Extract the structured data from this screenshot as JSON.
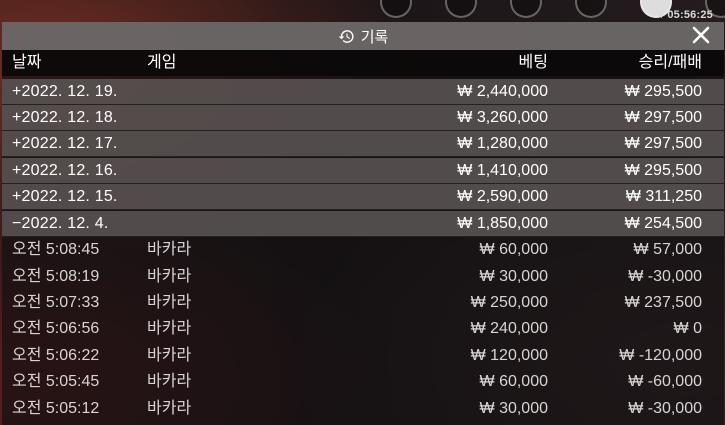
{
  "clock": "# 05:56:25",
  "title": "기록",
  "header": {
    "date": "날짜",
    "game": "게임",
    "bet": "베팅",
    "winloss": "승리/패배"
  },
  "summary_rows": [
    {
      "date": "+2022. 12. 19.",
      "bet": "₩ 2,440,000",
      "win": "₩ 295,500"
    },
    {
      "date": "+2022. 12. 18.",
      "bet": "₩ 3,260,000",
      "win": "₩ 297,500"
    },
    {
      "date": "+2022. 12. 17.",
      "bet": "₩ 1,280,000",
      "win": "₩ 297,500"
    },
    {
      "date": "+2022. 12. 16.",
      "bet": "₩ 1,410,000",
      "win": "₩ 295,500"
    },
    {
      "date": "+2022. 12. 15.",
      "bet": "₩ 2,590,000",
      "win": "₩ 311,250"
    },
    {
      "date": "−2022. 12. 4.",
      "bet": "₩ 1,850,000",
      "win": "₩ 254,500"
    }
  ],
  "detail_rows": [
    {
      "time": "오전 5:08:45",
      "game": "바카라",
      "bet": "₩ 60,000",
      "win": "₩ 57,000"
    },
    {
      "time": "오전 5:08:19",
      "game": "바카라",
      "bet": "₩ 30,000",
      "win": "₩ -30,000"
    },
    {
      "time": "오전 5:07:33",
      "game": "바카라",
      "bet": "₩ 250,000",
      "win": "₩ 237,500"
    },
    {
      "time": "오전 5:06:56",
      "game": "바카라",
      "bet": "₩ 240,000",
      "win": "₩ 0"
    },
    {
      "time": "오전 5:06:22",
      "game": "바카라",
      "bet": "₩ 120,000",
      "win": "₩ -120,000"
    },
    {
      "time": "오전 5:05:45",
      "game": "바카라",
      "bet": "₩ 60,000",
      "win": "₩ -60,000"
    },
    {
      "time": "오전 5:05:12",
      "game": "바카라",
      "bet": "₩ 30,000",
      "win": "₩ -30,000"
    }
  ],
  "icons": {
    "title_icon": "history-icon",
    "close_icon": "close-icon"
  }
}
